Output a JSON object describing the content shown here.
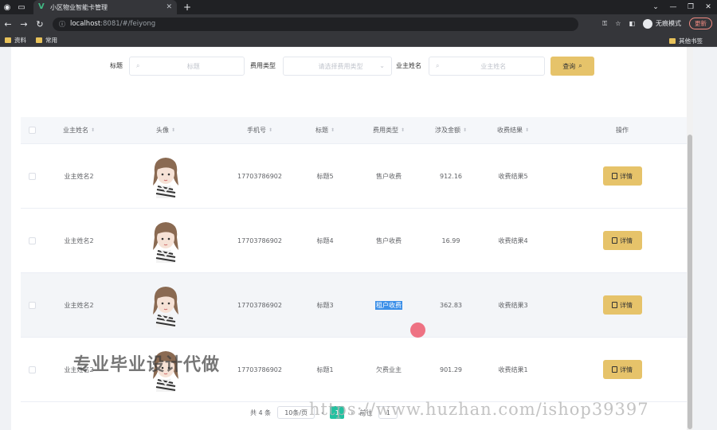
{
  "browser": {
    "tab_title": "小区物业智能卡管理",
    "url_host": "localhost",
    "url_path": ":8081/#/feiyong",
    "incognito_label": "无痕模式",
    "update_label": "更新",
    "bookmarks": [
      "资料",
      "常用"
    ],
    "other_bookmarks": "其他书签"
  },
  "search": {
    "title_label": "标题",
    "title_placeholder": "标题",
    "fee_type_label": "费用类型",
    "fee_type_placeholder": "请选择费用类型",
    "owner_label": "业主姓名",
    "owner_placeholder": "业主姓名",
    "query_button": "查询"
  },
  "table": {
    "headers": [
      "业主姓名",
      "头像",
      "手机号",
      "标题",
      "费用类型",
      "涉及金额",
      "收费结果",
      "操作"
    ],
    "detail_label": "详情",
    "rows": [
      {
        "owner": "业主姓名2",
        "phone": "17703786902",
        "title": "标题5",
        "fee_type": "售户收费",
        "amount": "912.16",
        "result": "收费结果5"
      },
      {
        "owner": "业主姓名2",
        "phone": "17703786902",
        "title": "标题4",
        "fee_type": "售户收费",
        "amount": "16.99",
        "result": "收费结果4"
      },
      {
        "owner": "业主姓名2",
        "phone": "17703786902",
        "title": "标题3",
        "fee_type": "租户收费",
        "amount": "362.83",
        "result": "收费结果3"
      },
      {
        "owner": "业主姓名2",
        "phone": "17703786902",
        "title": "标题1",
        "fee_type": "欠费业主",
        "amount": "901.29",
        "result": "收费结果1"
      }
    ]
  },
  "pager": {
    "total": "共 4 条",
    "page_size": "10条/页",
    "page": "1",
    "goto_prefix": "前往",
    "goto_value": "1"
  },
  "overlay": {
    "watermark": "专业毕业设计代做",
    "watermark_url": "https://www.huzhan.com/ishop39397"
  },
  "colors": {
    "accent": "#e6c36a",
    "pager_active": "#22c1a0",
    "selection": "#3b8fe8"
  }
}
